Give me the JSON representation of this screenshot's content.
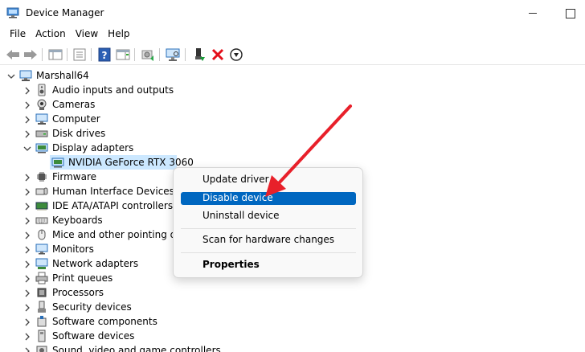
{
  "window": {
    "title": "Device Manager",
    "icon": "device-manager-icon"
  },
  "menu": [
    "File",
    "Action",
    "View",
    "Help"
  ],
  "toolbar": {
    "buttons": [
      "back-arrow-icon",
      "forward-arrow-icon",
      "show-hide-console-tree-icon",
      "properties-icon",
      "help-icon",
      "action-pane-icon",
      "update-driver-icon",
      "scan-hardware-icon",
      "enable-device-icon",
      "uninstall-device-icon",
      "disable-device-icon"
    ]
  },
  "tree": {
    "root": "Marshall64",
    "categories": [
      {
        "label": "Audio inputs and outputs",
        "icon": "speaker-icon"
      },
      {
        "label": "Cameras",
        "icon": "camera-icon"
      },
      {
        "label": "Computer",
        "icon": "computer-icon"
      },
      {
        "label": "Disk drives",
        "icon": "disk-drive-icon"
      },
      {
        "label": "Display adapters",
        "icon": "display-adapter-icon",
        "expanded": true,
        "children": [
          {
            "label": "NVIDIA GeForce RTX 3060",
            "icon": "display-adapter-icon",
            "selected": true
          }
        ]
      },
      {
        "label": "Firmware",
        "icon": "chip-icon"
      },
      {
        "label": "Human Interface Devices",
        "icon": "hid-icon"
      },
      {
        "label": "IDE ATA/ATAPI controllers",
        "icon": "controller-icon"
      },
      {
        "label": "Keyboards",
        "icon": "keyboard-icon"
      },
      {
        "label": "Mice and other pointing devices",
        "icon": "mouse-icon"
      },
      {
        "label": "Monitors",
        "icon": "monitor-icon"
      },
      {
        "label": "Network adapters",
        "icon": "network-adapter-icon"
      },
      {
        "label": "Print queues",
        "icon": "printer-icon"
      },
      {
        "label": "Processors",
        "icon": "processor-icon"
      },
      {
        "label": "Security devices",
        "icon": "security-device-icon"
      },
      {
        "label": "Software components",
        "icon": "software-component-icon"
      },
      {
        "label": "Software devices",
        "icon": "software-device-icon"
      },
      {
        "label": "Sound, video and game controllers",
        "icon": "sound-icon"
      }
    ]
  },
  "context_menu": {
    "items": [
      {
        "label": "Update driver"
      },
      {
        "label": "Disable device",
        "highlighted": true
      },
      {
        "label": "Uninstall device"
      },
      {
        "label": "Scan for hardware changes"
      },
      {
        "label": "Properties",
        "bold": true
      }
    ]
  },
  "colors": {
    "selection": "#cce8ff",
    "highlight": "#0067c0",
    "annotation_arrow": "#e8202a"
  }
}
